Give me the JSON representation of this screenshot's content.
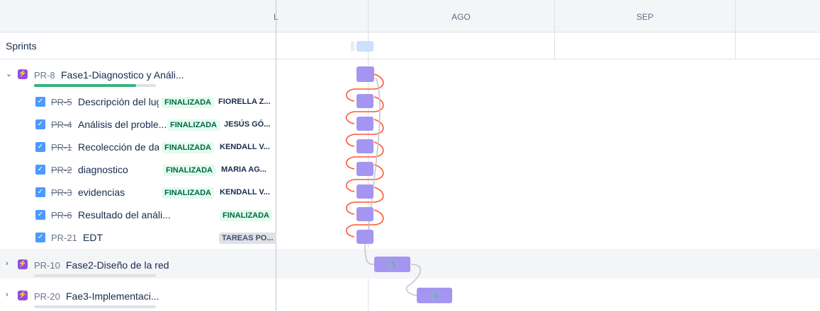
{
  "timeline": {
    "months": [
      "L",
      "AGO",
      "SEP"
    ],
    "sprints_label": "Sprints"
  },
  "epics": [
    {
      "key": "PR-8",
      "title": "Fase1-Diagnostico y Análi...",
      "expanded": true,
      "progress": 0.84
    },
    {
      "key": "PR-10",
      "title": "Fase2-Diseño de la red",
      "expanded": false,
      "progress": 0
    },
    {
      "key": "PR-20",
      "title": "Fae3-Implementaci...",
      "expanded": false,
      "progress": 0
    }
  ],
  "issues": [
    {
      "key": "PR-5",
      "title": "Descripción del lug",
      "status": "FINALIZADA",
      "assignee": "FIORELLA Z...",
      "done": true
    },
    {
      "key": "PR-4",
      "title": "Análisis del proble...",
      "status": "FINALIZADA",
      "assignee": "JESÚS GÓ...",
      "done": true
    },
    {
      "key": "PR-1",
      "title": "Recolección de da",
      "status": "FINALIZADA",
      "assignee": "KENDALL V...",
      "done": true
    },
    {
      "key": "PR-2",
      "title": "diagnostico",
      "status": "FINALIZADA",
      "assignee": "MARIA AG...",
      "done": true
    },
    {
      "key": "PR-3",
      "title": "evidencias",
      "status": "FINALIZADA",
      "assignee": "KENDALL V...",
      "done": true
    },
    {
      "key": "PR-6",
      "title": "Resultado del análi...",
      "status": "FINALIZADA",
      "assignee": "",
      "done": true
    },
    {
      "key": "PR-21",
      "title": "EDT",
      "status": "TAREAS PO...",
      "assignee": "",
      "done": false
    }
  ],
  "icons": {
    "epic": "lightning-icon",
    "check": "checkbox-icon",
    "link": "link-icon",
    "expand": "chevron-icon"
  },
  "colors": {
    "epic_bar": "#a496f0",
    "dependency_line": "#ff5630",
    "progress": "#36b37e",
    "status_done_bg": "#e3fcef",
    "status_done_text": "#006644"
  }
}
